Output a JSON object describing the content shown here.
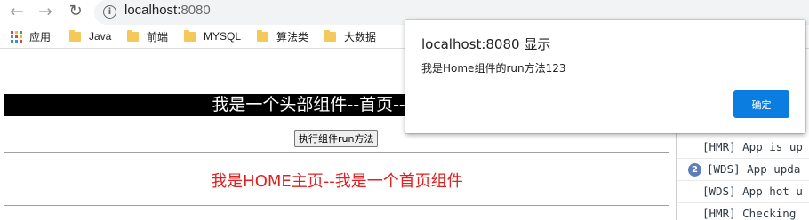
{
  "browser": {
    "url_host": "localhost:",
    "url_port": "8080",
    "bookmarks": [
      {
        "label": "应用",
        "icon": "apps-grid-icon"
      },
      {
        "label": "Java",
        "icon": "folder-icon"
      },
      {
        "label": "前端",
        "icon": "folder-icon"
      },
      {
        "label": "MYSQL",
        "icon": "folder-icon"
      },
      {
        "label": "算法类",
        "icon": "folder-icon"
      },
      {
        "label": "大数据",
        "icon": "folder-icon"
      }
    ]
  },
  "page": {
    "header_text": "我是一个头部组件--首页---我是一",
    "run_button_label": "执行组件run方法",
    "home_text": "我是HOME主页--我是一个首页组件"
  },
  "console": {
    "logs": [
      {
        "text": "[HMR] App is up",
        "count": ""
      },
      {
        "text": "[WDS] App upda",
        "count": "2"
      },
      {
        "text": "[WDS] App hot u",
        "count": ""
      },
      {
        "text": "[HMR] Checking",
        "count": ""
      }
    ]
  },
  "dialog": {
    "title": "localhost:8080 显示",
    "message": "我是Home组件的run方法123",
    "ok_label": "确定"
  },
  "colors": {
    "accent": "#0b7de0",
    "header_bg": "#000000",
    "home_text": "#e02020"
  }
}
